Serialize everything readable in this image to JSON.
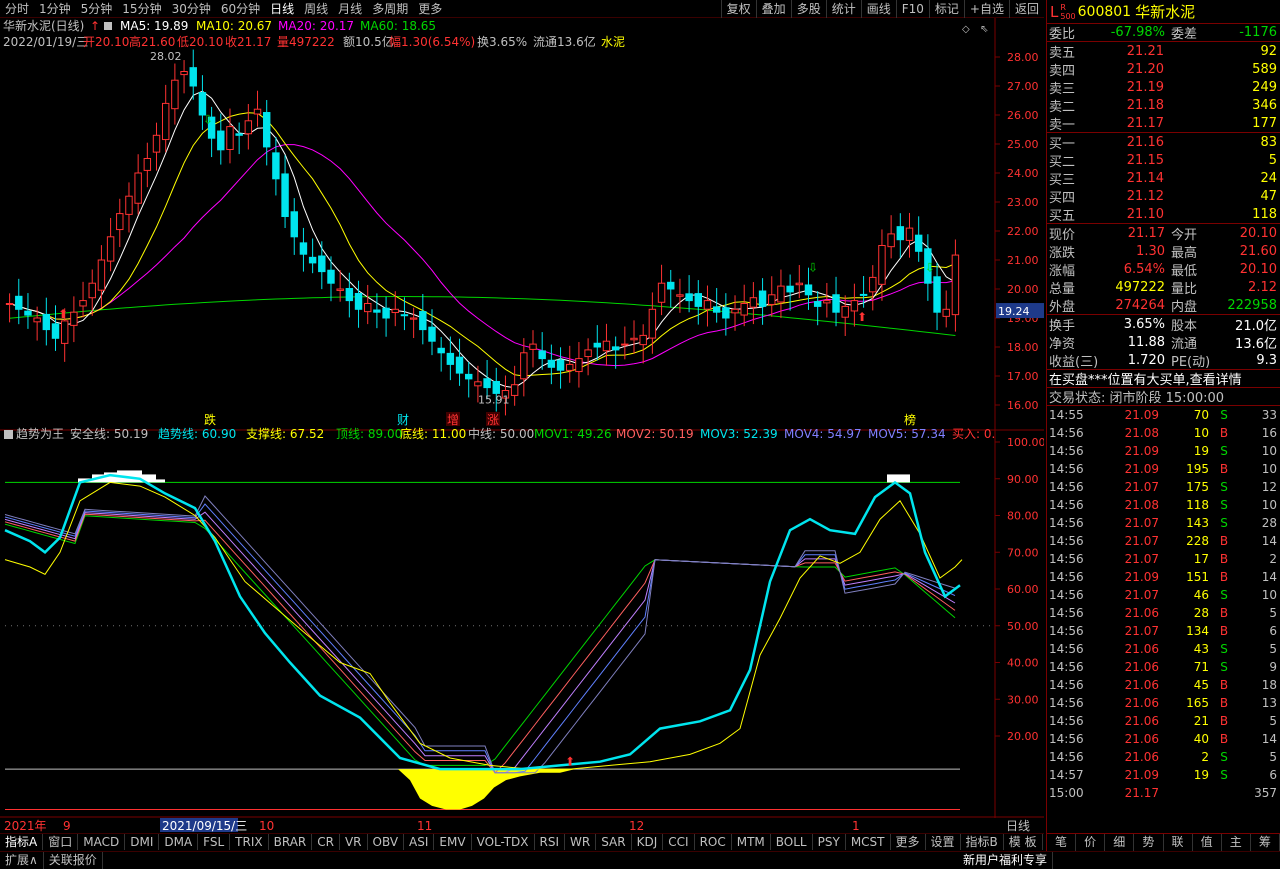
{
  "periods": [
    "分时",
    "1分钟",
    "5分钟",
    "15分钟",
    "30分钟",
    "60分钟",
    "日线",
    "周线",
    "月线",
    "多周期",
    "更多"
  ],
  "active_period": 6,
  "tools": [
    "复权",
    "叠加",
    "多股",
    "统计",
    "画线",
    "F10",
    "标记",
    "+自选",
    "返回"
  ],
  "header": {
    "title": "华新水泥(日线)",
    "ma5": "MA5: 19.89",
    "ma10": "MA10: 20.67",
    "ma20": "MA20: 20.17",
    "ma60": "MA60: 18.65",
    "info_date": "2022/01/19/三",
    "info_open": "开20.10",
    "info_high": "高21.60",
    "info_low": "低20.10",
    "info_close": "收21.17",
    "info_vol": "量497222",
    "info_amt": "额10.5亿",
    "info_change": "幅1.30(6.54%)",
    "info_turn": "换3.65%",
    "info_float": "流通13.6亿",
    "info_sector": "水泥"
  },
  "colors": {
    "up": "#ff3232",
    "down": "#00e5ee",
    "ma5": "#ffffff",
    "ma10": "#ffff00",
    "ma20": "#ff00ff",
    "ma60": "#00d600",
    "grid": "#7a0000"
  },
  "price_axis": [
    "28.00",
    "27.00",
    "26.00",
    "25.00",
    "24.00",
    "23.00",
    "22.00",
    "21.00",
    "20.00",
    "19.00",
    "18.00",
    "17.00",
    "16.00"
  ],
  "current_price_tag": "19.24",
  "high_label": "28.02",
  "low_label": "15.91",
  "markers": [
    "跌",
    "财",
    "增",
    "涨",
    "榜"
  ],
  "indicator": {
    "name": "趋势为王",
    "safe": "安全线: 50.19",
    "trend": "趋势线: 60.90",
    "support": "支撑线: 67.52",
    "top": "顶线: 89.00",
    "bottom": "底线: 11.00",
    "mid": "中线: 50.00",
    "mov1": "MOV1: 49.26",
    "mov2": "MOV2: 50.19",
    "mov3": "MOV3: 52.39",
    "mov4": "MOV4: 54.97",
    "mov5": "MOV5: 57.34",
    "buy": "买入: 0."
  },
  "ind_axis": [
    "100.00",
    "90.00",
    "80.00",
    "70.00",
    "60.00",
    "50.00",
    "40.00",
    "30.00",
    "20.00"
  ],
  "time_axis": {
    "year": "2021年",
    "m9": "9",
    "cursor_date": "2021/09/15/三",
    "m10": "10",
    "m11": "11",
    "m12": "12",
    "m1": "1",
    "period_label": "日线"
  },
  "bottom_tabs": [
    "指标A",
    "窗口",
    "MACD",
    "DMI",
    "DMA",
    "FSL",
    "TRIX",
    "BRAR",
    "CR",
    "VR",
    "OBV",
    "ASI",
    "EMV",
    "VOL-TDX",
    "RSI",
    "WR",
    "SAR",
    "KDJ",
    "CCI",
    "ROC",
    "MTM",
    "BOLL",
    "PSY",
    "MCST",
    "更多",
    "设置"
  ],
  "bottom_right": [
    "指标B",
    "模 板",
    "+",
    "-"
  ],
  "status": [
    "扩展∧",
    "关联报价"
  ],
  "status_right": "新用户福利专享",
  "panel": {
    "code": "600801",
    "name": "华新水泥",
    "market_tag": "L",
    "weibi_label": "委比",
    "weibi": "-67.98%",
    "weicha_label": "委差",
    "weicha": "-1176",
    "asks": [
      {
        "label": "卖五",
        "price": "21.21",
        "vol": "92"
      },
      {
        "label": "卖四",
        "price": "21.20",
        "vol": "589"
      },
      {
        "label": "卖三",
        "price": "21.19",
        "vol": "249"
      },
      {
        "label": "卖二",
        "price": "21.18",
        "vol": "346"
      },
      {
        "label": "卖一",
        "price": "21.17",
        "vol": "177"
      }
    ],
    "bids": [
      {
        "label": "买一",
        "price": "21.16",
        "vol": "83"
      },
      {
        "label": "买二",
        "price": "21.15",
        "vol": "5"
      },
      {
        "label": "买三",
        "price": "21.14",
        "vol": "24"
      },
      {
        "label": "买四",
        "price": "21.12",
        "vol": "47"
      },
      {
        "label": "买五",
        "price": "21.10",
        "vol": "118"
      }
    ],
    "stats": [
      {
        "l1": "现价",
        "v1": "21.17",
        "l2": "今开",
        "v2": "20.10"
      },
      {
        "l1": "涨跌",
        "v1": "1.30",
        "l2": "最高",
        "v2": "21.60"
      },
      {
        "l1": "涨幅",
        "v1": "6.54%",
        "l2": "最低",
        "v2": "20.10"
      },
      {
        "l1": "总量",
        "v1": "497222",
        "l2": "量比",
        "v2": "2.12"
      },
      {
        "l1": "外盘",
        "v1": "274264",
        "l2": "内盘",
        "v2": "222958"
      }
    ],
    "stats2": [
      {
        "l1": "换手",
        "v1": "3.65%",
        "l2": "股本",
        "v2": "21.0亿"
      },
      {
        "l1": "净资",
        "v1": "11.88",
        "l2": "流通",
        "v2": "13.6亿"
      },
      {
        "l1": "收益(三)",
        "v1": "1.720",
        "l2": "PE(动)",
        "v2": "9.3"
      }
    ],
    "news": "在买盘***位置有大买单,查看详情",
    "trade_state": "交易状态: 闭市阶段 15:00:00",
    "ticks": [
      [
        "14:55",
        "21.09",
        "70",
        "S",
        "33"
      ],
      [
        "14:56",
        "21.08",
        "10",
        "B",
        "16"
      ],
      [
        "14:56",
        "21.09",
        "19",
        "S",
        "10"
      ],
      [
        "14:56",
        "21.09",
        "195",
        "B",
        "10"
      ],
      [
        "14:56",
        "21.07",
        "175",
        "S",
        "12"
      ],
      [
        "14:56",
        "21.08",
        "118",
        "S",
        "10"
      ],
      [
        "14:56",
        "21.07",
        "143",
        "S",
        "28"
      ],
      [
        "14:56",
        "21.07",
        "228",
        "B",
        "14"
      ],
      [
        "14:56",
        "21.07",
        "17",
        "B",
        "2"
      ],
      [
        "14:56",
        "21.09",
        "151",
        "B",
        "14"
      ],
      [
        "14:56",
        "21.07",
        "46",
        "S",
        "10"
      ],
      [
        "14:56",
        "21.06",
        "28",
        "B",
        "5"
      ],
      [
        "14:56",
        "21.07",
        "134",
        "B",
        "6"
      ],
      [
        "14:56",
        "21.06",
        "43",
        "S",
        "5"
      ],
      [
        "14:56",
        "21.06",
        "71",
        "S",
        "9"
      ],
      [
        "14:56",
        "21.06",
        "45",
        "B",
        "18"
      ],
      [
        "14:56",
        "21.06",
        "165",
        "B",
        "13"
      ],
      [
        "14:56",
        "21.06",
        "21",
        "B",
        "5"
      ],
      [
        "14:56",
        "21.06",
        "40",
        "B",
        "14"
      ],
      [
        "14:56",
        "21.06",
        "2",
        "S",
        "5"
      ],
      [
        "14:57",
        "21.09",
        "19",
        "S",
        "6"
      ],
      [
        "15:00",
        "21.17",
        "",
        "",
        "357"
      ]
    ],
    "bottom_tabs": [
      "笔",
      "价",
      "细",
      "势",
      "联",
      "值",
      "主",
      "筹"
    ]
  }
}
